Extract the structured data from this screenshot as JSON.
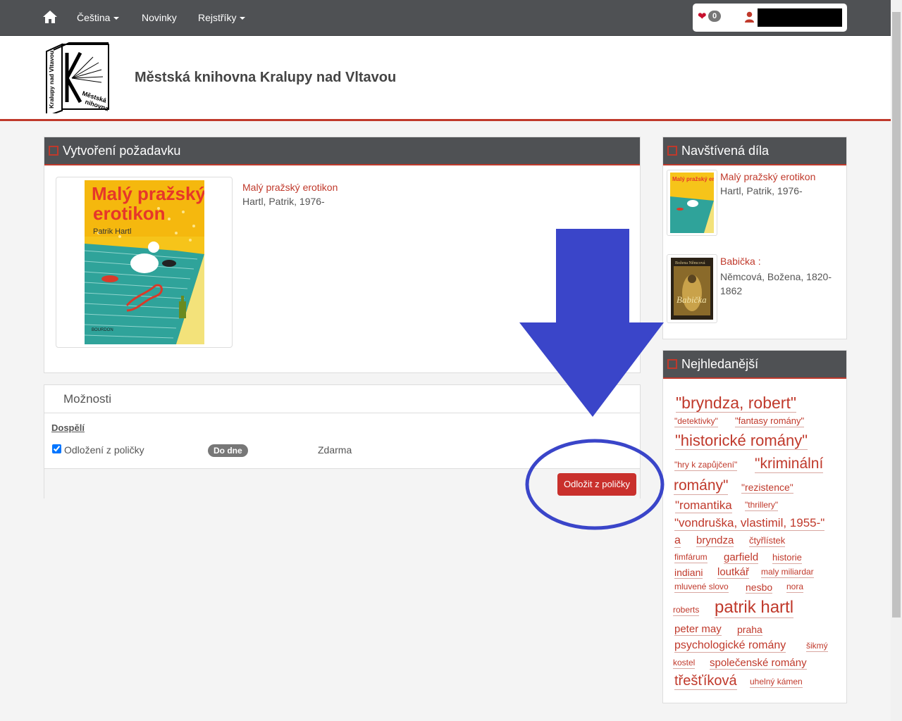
{
  "nav": {
    "language": "Čeština",
    "news": "Novinky",
    "registers": "Rejstříky",
    "cart_count": "0"
  },
  "header": {
    "title": "Městská knihovna Kralupy nad Vltavou"
  },
  "logo": {
    "spine_text": "Kralupy nad Vltavou",
    "cover_text_1": "Městská",
    "cover_text_2": "nihovna"
  },
  "request_panel": {
    "title": "Vytvoření požadavku",
    "book_title": "Malý pražský erotikon",
    "book_author": "Hartl, Patrik, 1976-",
    "cover": {
      "title_line1": "Malý pražský",
      "title_line2": "erotikon",
      "author": "Patrik Hartl",
      "publisher": "BOURDON"
    }
  },
  "options_panel": {
    "title": "Možnosti",
    "group": "Dospělí",
    "option_label": "Odložení z poličky",
    "option_checked": true,
    "until_badge": "Do dne",
    "price": "Zdarma",
    "submit_label": "Odložit z poličky"
  },
  "visited_panel": {
    "title": "Navštívená díla",
    "items": [
      {
        "title": "Malý pražský erotikon",
        "author": "Hartl, Patrik, 1976-",
        "cover_text": "Malý pražský erotikon"
      },
      {
        "title": "Babička :",
        "author": "Němcová, Božena, 1820-1862",
        "cover_text": "Babička",
        "cover_author": "Božena Němcová"
      }
    ]
  },
  "popular_panel": {
    "title": "Nejhledanější",
    "tags": [
      "\"bryndza, robert\"",
      "\"detektivky\"",
      "\"fantasy romány\"",
      "\"historické romány\"",
      "\"hry k zapůjčení\"",
      "\"kriminální",
      "romány\"",
      "\"rezistence\"",
      "\"romantika",
      "\"thrillery\"",
      "\"vondruška, vlastimil, 1955-\"",
      "a",
      "bryndza",
      "čtyřlístek",
      "fimfárum",
      "garfield",
      "historie",
      "indiani",
      "loutkář",
      "maly miliardar",
      "mluvené slovo",
      "nesbo",
      "nora",
      "roberts",
      "patrik hartl",
      "peter may",
      "praha",
      "psychologické romány",
      "šikmý",
      "kostel",
      "společenské romány",
      "třešťíková",
      "uhelný kámen"
    ]
  },
  "colors": {
    "brand_red": "#c0392b",
    "nav_dark": "#4f5154",
    "annotation_blue": "#3a45c9"
  },
  "icons": [
    "home-icon",
    "heart-icon",
    "user-icon",
    "checkbox-icon"
  ]
}
